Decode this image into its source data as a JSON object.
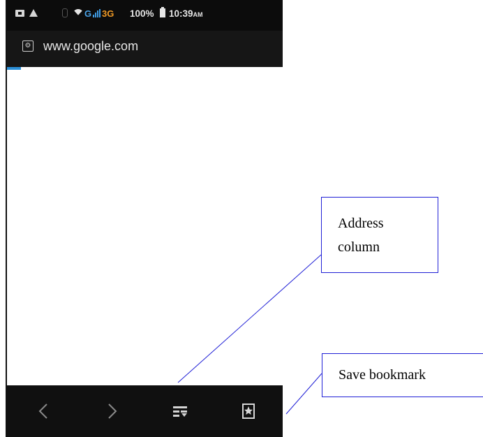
{
  "status_bar": {
    "network_g": "G",
    "network_3g": "3G",
    "battery": "100%",
    "time": "10:39",
    "ampm": "AM"
  },
  "browser": {
    "url": "www.google.com",
    "site_icon": "browser-site-icon",
    "accent_color": "#2a8fd8"
  },
  "nav_bar": {
    "icons": [
      "back-chevron-icon",
      "forward-chevron-icon",
      "tabs-list-icon",
      "bookmark-icon"
    ]
  },
  "annotations": {
    "address_line1": "Address",
    "address_line2": "column",
    "save_bookmark": "Save bookmark",
    "line_color": "#1f1fd6"
  }
}
